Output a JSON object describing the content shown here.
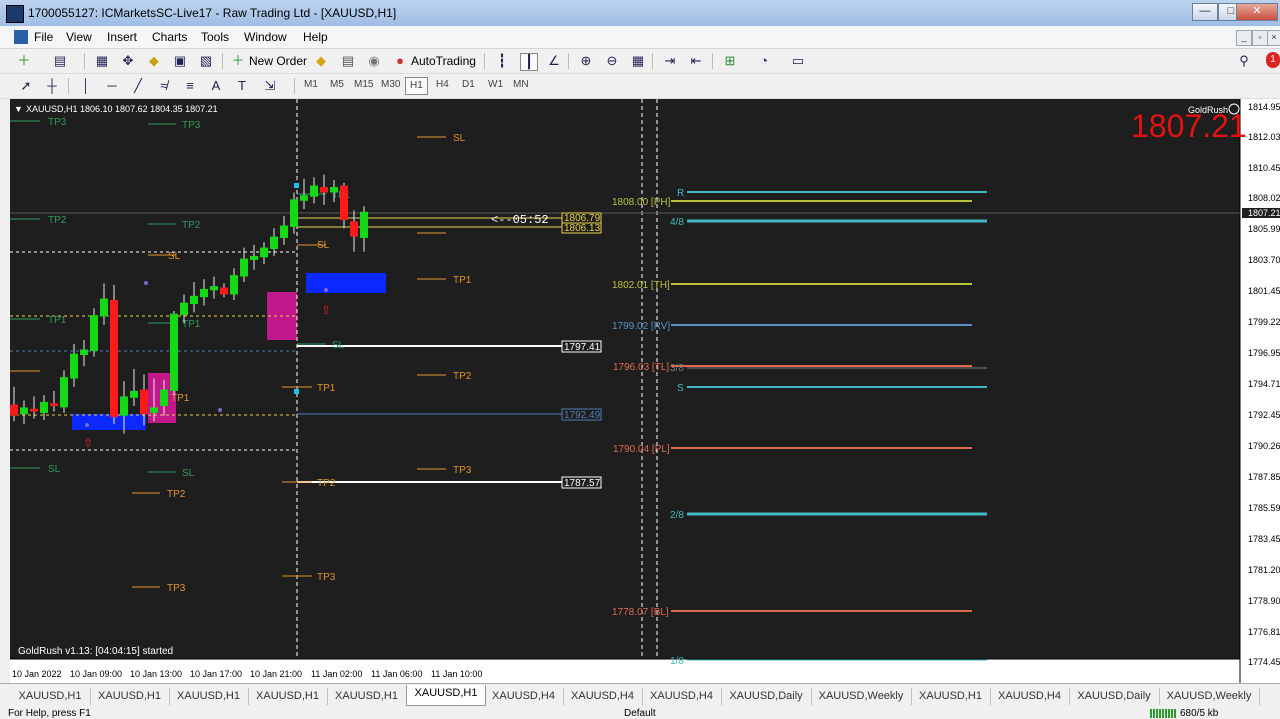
{
  "window": {
    "title": "1700055127: ICMarketsSC-Live17 - Raw Trading Ltd - [XAUUSD,H1]",
    "minimize": "—",
    "maximize": "□",
    "close": "✕"
  },
  "menu": [
    "File",
    "View",
    "Insert",
    "Charts",
    "Tools",
    "Window",
    "Help"
  ],
  "toolbar": {
    "new_order": "New Order",
    "auto_trading": "AutoTrading"
  },
  "timeframes": [
    "M1",
    "M5",
    "M15",
    "M30",
    "H1",
    "H4",
    "D1",
    "W1",
    "MN"
  ],
  "active_timeframe": "H1",
  "chart": {
    "header": "XAUUSD,H1  1806.10 1807.62 1804.35 1807.21",
    "big_price": "1807.21",
    "big_price_color": "#e51010",
    "badge": "GoldRush",
    "status_text": "GoldRush v1.13: [04:04:15] started",
    "countdown": "<--05:52",
    "price_axis": [
      "1814.95",
      "1812.03",
      "1810.45",
      "1808.02",
      "1807.21",
      "1805.99",
      "1803.70",
      "1801.45",
      "1799.22",
      "1796.95",
      "1794.71",
      "1792.45",
      "1790.26",
      "1787.85",
      "1785.59",
      "1783.45",
      "1781.20",
      "1778.90",
      "1776.81",
      "1774.45"
    ],
    "time_axis": [
      "10 Jan 2022",
      "10 Jan 09:00",
      "10 Jan 13:00",
      "10 Jan 17:00",
      "10 Jan 21:00",
      "11 Jan 02:00",
      "11 Jan 06:00",
      "11 Jan 10:00"
    ],
    "price_boxes": [
      {
        "text": "1806.79",
        "color": "#e8d24a"
      },
      {
        "text": "1806.13",
        "color": "#e8d24a"
      },
      {
        "text": "1797.41",
        "color": "#ffffff"
      },
      {
        "text": "1792.49",
        "color": "#4f7fb8"
      },
      {
        "text": "1787.57",
        "color": "#ffffff"
      }
    ],
    "pivot_labels": [
      {
        "text": "1808.00 [PH]",
        "color": "#b9c23a"
      },
      {
        "text": "1802.01 [TH]",
        "color": "#b9c23a"
      },
      {
        "text": "1799.02 [RV]",
        "color": "#5b8fc6"
      },
      {
        "text": "1796.03 [TL]",
        "color": "#e06a50"
      },
      {
        "text": "1790.04 [PL]",
        "color": "#e06a50"
      },
      {
        "text": "1778.07 [BL]",
        "color": "#e06a50"
      }
    ],
    "right_labels": [
      "R",
      "4/8",
      "3/8",
      "S",
      "2/8",
      "1/8"
    ],
    "level_labels": [
      "TP3",
      "TP2",
      "TP1",
      "SL"
    ],
    "candles": [
      {
        "o": 1793.2,
        "h": 1794.5,
        "l": 1792.0,
        "c": 1792.4
      },
      {
        "o": 1792.5,
        "h": 1793.5,
        "l": 1791.8,
        "c": 1793.0
      },
      {
        "o": 1792.9,
        "h": 1793.8,
        "l": 1792.2,
        "c": 1792.7
      },
      {
        "o": 1792.6,
        "h": 1793.9,
        "l": 1792.1,
        "c": 1793.4
      },
      {
        "o": 1793.3,
        "h": 1794.2,
        "l": 1792.7,
        "c": 1793.1
      },
      {
        "o": 1793.0,
        "h": 1795.7,
        "l": 1792.6,
        "c": 1795.2
      },
      {
        "o": 1795.1,
        "h": 1797.6,
        "l": 1794.5,
        "c": 1796.9
      },
      {
        "o": 1796.8,
        "h": 1797.9,
        "l": 1796.0,
        "c": 1797.2
      },
      {
        "o": 1797.1,
        "h": 1800.2,
        "l": 1796.7,
        "c": 1799.7
      },
      {
        "o": 1799.6,
        "h": 1802.0,
        "l": 1799.0,
        "c": 1800.9
      },
      {
        "o": 1800.8,
        "h": 1801.9,
        "l": 1791.8,
        "c": 1792.3
      },
      {
        "o": 1792.4,
        "h": 1794.9,
        "l": 1791.1,
        "c": 1793.8
      },
      {
        "o": 1793.7,
        "h": 1795.8,
        "l": 1793.1,
        "c": 1794.2
      },
      {
        "o": 1794.3,
        "h": 1795.4,
        "l": 1791.7,
        "c": 1792.5
      },
      {
        "o": 1792.6,
        "h": 1795.1,
        "l": 1792.0,
        "c": 1793.0
      },
      {
        "o": 1793.1,
        "h": 1795.0,
        "l": 1792.4,
        "c": 1794.3
      },
      {
        "o": 1794.2,
        "h": 1800.0,
        "l": 1793.9,
        "c": 1799.8
      },
      {
        "o": 1799.7,
        "h": 1801.2,
        "l": 1799.1,
        "c": 1800.6
      },
      {
        "o": 1800.5,
        "h": 1802.1,
        "l": 1799.9,
        "c": 1801.1
      },
      {
        "o": 1801.0,
        "h": 1802.3,
        "l": 1800.4,
        "c": 1801.6
      },
      {
        "o": 1801.5,
        "h": 1802.5,
        "l": 1800.9,
        "c": 1801.8
      },
      {
        "o": 1801.7,
        "h": 1802.0,
        "l": 1801.0,
        "c": 1801.2
      },
      {
        "o": 1801.2,
        "h": 1803.1,
        "l": 1800.8,
        "c": 1802.6
      },
      {
        "o": 1802.5,
        "h": 1804.6,
        "l": 1802.1,
        "c": 1803.8
      },
      {
        "o": 1803.7,
        "h": 1804.8,
        "l": 1803.0,
        "c": 1804.0
      },
      {
        "o": 1803.9,
        "h": 1805.0,
        "l": 1803.4,
        "c": 1804.6
      },
      {
        "o": 1804.5,
        "h": 1806.0,
        "l": 1804.0,
        "c": 1805.4
      },
      {
        "o": 1805.3,
        "h": 1806.9,
        "l": 1804.8,
        "c": 1806.2
      },
      {
        "o": 1806.1,
        "h": 1808.6,
        "l": 1805.6,
        "c": 1808.1
      },
      {
        "o": 1808.0,
        "h": 1809.6,
        "l": 1807.4,
        "c": 1808.4
      },
      {
        "o": 1808.3,
        "h": 1809.7,
        "l": 1807.8,
        "c": 1809.1
      },
      {
        "o": 1809.0,
        "h": 1809.9,
        "l": 1807.7,
        "c": 1808.6
      },
      {
        "o": 1808.6,
        "h": 1809.5,
        "l": 1807.9,
        "c": 1809.0
      },
      {
        "o": 1809.1,
        "h": 1809.3,
        "l": 1806.0,
        "c": 1806.6
      },
      {
        "o": 1806.5,
        "h": 1807.3,
        "l": 1804.3,
        "c": 1805.4
      },
      {
        "o": 1805.3,
        "h": 1807.6,
        "l": 1804.3,
        "c": 1807.2
      }
    ]
  },
  "tabs": [
    {
      "label": "XAUUSD,H1",
      "active": false
    },
    {
      "label": "XAUUSD,H1",
      "active": false
    },
    {
      "label": "XAUUSD,H1",
      "active": false
    },
    {
      "label": "XAUUSD,H1",
      "active": false
    },
    {
      "label": "XAUUSD,H1",
      "active": false
    },
    {
      "label": "XAUUSD,H1",
      "active": true
    },
    {
      "label": "XAUUSD,H4",
      "active": false
    },
    {
      "label": "XAUUSD,H4",
      "active": false
    },
    {
      "label": "XAUUSD,H4",
      "active": false
    },
    {
      "label": "XAUUSD,Daily",
      "active": false
    },
    {
      "label": "XAUUSD,Weekly",
      "active": false
    },
    {
      "label": "XAUUSD,H1",
      "active": false
    },
    {
      "label": "XAUUSD,H4",
      "active": false
    },
    {
      "label": "XAUUSD,Daily",
      "active": false
    },
    {
      "label": "XAUUSD,Weekly",
      "active": false
    }
  ],
  "status": {
    "help": "For Help, press F1",
    "profile": "Default",
    "traffic": "680/5 kb"
  }
}
